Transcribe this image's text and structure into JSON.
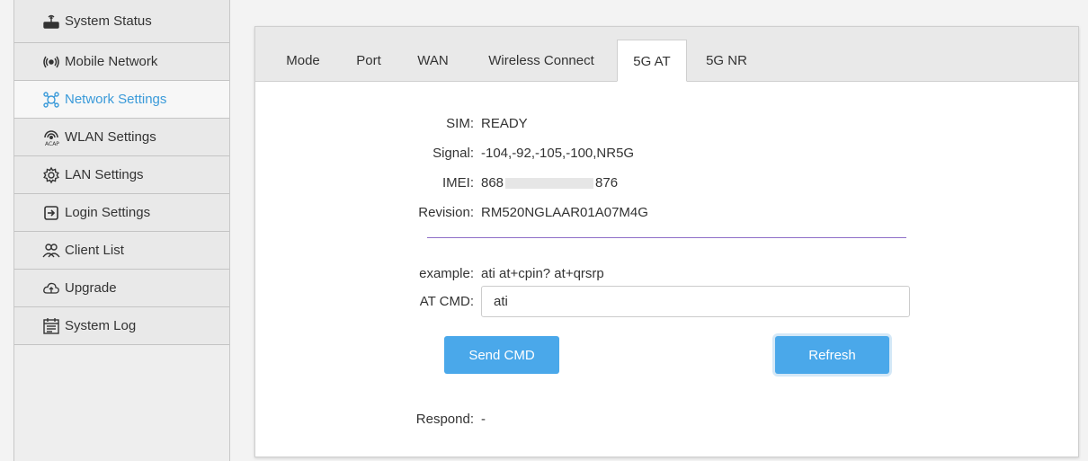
{
  "sidebar": {
    "items": [
      {
        "label": "System Status",
        "icon": "router-icon"
      },
      {
        "label": "Mobile Network",
        "icon": "radio-waves-icon"
      },
      {
        "label": "Network Settings",
        "icon": "network-icon",
        "active": true
      },
      {
        "label": "WLAN Settings",
        "icon": "wlan-acap-icon"
      },
      {
        "label": "LAN Settings",
        "icon": "gear-icon"
      },
      {
        "label": "Login Settings",
        "icon": "login-icon"
      },
      {
        "label": "Client List",
        "icon": "users-icon"
      },
      {
        "label": "Upgrade",
        "icon": "cloud-upload-icon"
      },
      {
        "label": "System Log",
        "icon": "calendar-log-icon"
      }
    ]
  },
  "tabs": [
    "Mode",
    "Port",
    "WAN",
    "Wireless Connect",
    "5G AT",
    "5G NR"
  ],
  "active_tab": "5G AT",
  "info": {
    "sim_label": "SIM:",
    "sim_value": "READY",
    "signal_label": "Signal:",
    "signal_value": "-104,-92,-105,-100,NR5G",
    "imei_label": "IMEI:",
    "imei_prefix": "868",
    "imei_suffix": "876",
    "revision_label": "Revision:",
    "revision_value": "RM520NGLAAR01A07M4G"
  },
  "at": {
    "example_label": "example:",
    "example_value": "ati at+cpin? at+qrsrp",
    "cmd_label": "AT CMD:",
    "cmd_value": "ati",
    "send_label": "Send CMD",
    "refresh_label": "Refresh",
    "respond_label": "Respond:",
    "respond_value": "-"
  },
  "colors": {
    "accent": "#4aa8ea",
    "active_text": "#3a9ad9",
    "divider": "#8e6fc8"
  }
}
